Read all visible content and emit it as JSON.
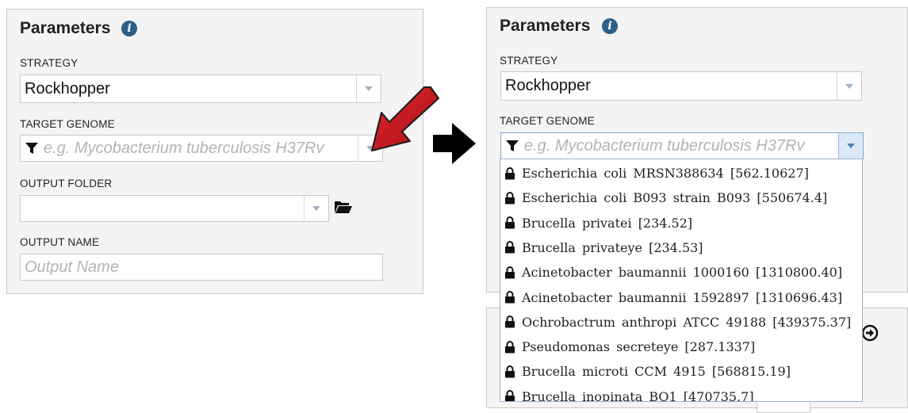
{
  "left_panel": {
    "title": "Parameters",
    "strategy_label": "STRATEGY",
    "strategy_value": "Rockhopper",
    "target_genome_label": "TARGET GENOME",
    "target_genome_placeholder": "e.g. Mycobacterium tuberculosis H37Rv",
    "output_folder_label": "OUTPUT FOLDER",
    "output_folder_value": "",
    "output_name_label": "OUTPUT NAME",
    "output_name_placeholder": "Output Name"
  },
  "right_panel": {
    "title": "Parameters",
    "strategy_label": "STRATEGY",
    "strategy_value": "Rockhopper",
    "target_genome_label": "TARGET GENOME",
    "target_genome_placeholder": "e.g. Mycobacterium tuberculosis H37Rv"
  },
  "dropdown": {
    "items": [
      "Escherichia coli MRSN388634 [562.10627]",
      "Escherichia coli B093 strain B093 [550674.4]",
      "Brucella privatei [234.52]",
      "Brucella privateye [234.53]",
      "Acinetobacter baumannii 1000160 [1310800.40]",
      "Acinetobacter baumannii 1592897 [1310696.43]",
      "Ochrobactrum anthropi ATCC 49188 [439375.37]",
      "Pseudomonas secreteye [287.1337]",
      "Brucella microti CCM 4915 [568815.19]",
      "Brucella inopinata BO1 [470735.7]"
    ]
  },
  "colors": {
    "annotation_arrow": "#c8141c",
    "flow_arrow": "#000000",
    "info_icon": "#2f5f86",
    "panel_bg": "#f4f4f4"
  },
  "icons": {
    "info": "i",
    "filter": "filter-icon",
    "folder": "folder-open-icon",
    "lock": "lock-icon",
    "next": "circle-arrow-right-icon"
  }
}
